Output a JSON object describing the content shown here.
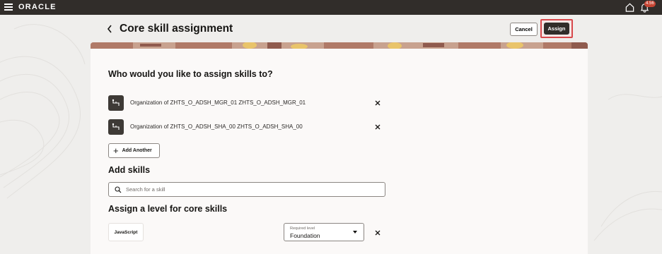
{
  "app": {
    "brand": "ORACLE",
    "notification_count": "4.56"
  },
  "header": {
    "title": "Core skill assignment",
    "cancel_label": "Cancel",
    "assign_label": "Assign"
  },
  "assign_to": {
    "heading": "Who would you like to assign skills to?",
    "items": [
      {
        "label": "Organization of ZHTS_O_ADSH_MGR_01 ZHTS_O_ADSH_MGR_01"
      },
      {
        "label": "Organization of ZHTS_O_ADSH_SHA_00 ZHTS_O_ADSH_SHA_00"
      }
    ],
    "add_another_label": "Add Another"
  },
  "add_skills": {
    "heading": "Add skills",
    "search_placeholder": "Search for a skill"
  },
  "levels": {
    "heading": "Assign a level for core skills",
    "rows": [
      {
        "skill": "JavaScript",
        "caption": "Required level",
        "value": "Foundation"
      }
    ]
  },
  "colors": {
    "topbar": "#312d2a",
    "primary_button": "#312d2a",
    "highlight": "#d8484b",
    "banner": "#c8a28f"
  },
  "icons": [
    "hamburger-icon",
    "home-icon",
    "bell-icon",
    "chevron-left-icon",
    "org-chart-icon",
    "close-icon",
    "plus-icon",
    "search-icon",
    "chevron-down-icon"
  ]
}
